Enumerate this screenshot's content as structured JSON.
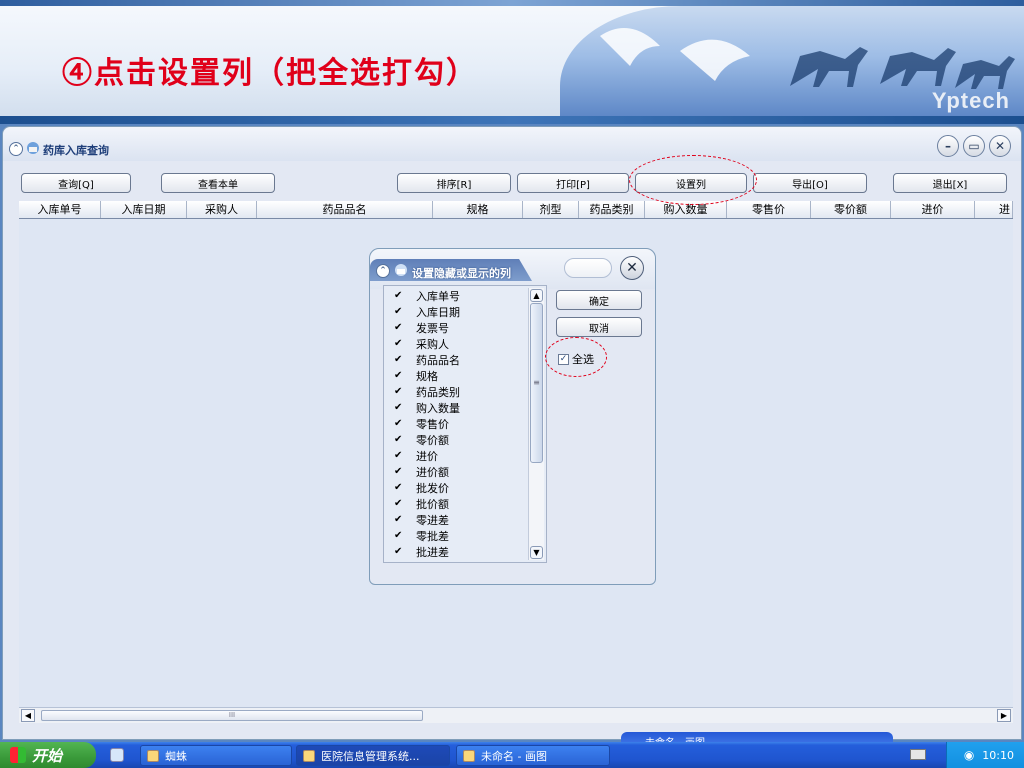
{
  "banner": {
    "title": "④点击设置列（把全选打勾）",
    "brand": "Yptech"
  },
  "main_window": {
    "title": "药库入库查询",
    "controls": {
      "minimize": "–",
      "restore": "▭",
      "close": "✕"
    },
    "toolbar": {
      "query": "查询[Q]",
      "view_order": "查看本单",
      "sort": "排序[R]",
      "print": "打印[P]",
      "set_columns": "设置列",
      "export": "导出[O]",
      "exit": "退出[X]"
    },
    "columns": [
      "入库单号",
      "入库日期",
      "采购人",
      "药品品名",
      "规格",
      "剂型",
      "药品类别",
      "购入数量",
      "零售价",
      "零价额",
      "进价",
      "进"
    ],
    "scroll": {
      "left": "◀",
      "right": "▶",
      "thumb": "III"
    }
  },
  "dialog": {
    "title": "设置隐藏或显示的列",
    "close": "✕",
    "items": [
      {
        "label": "入库单号",
        "checked": true
      },
      {
        "label": "入库日期",
        "checked": true
      },
      {
        "label": "发票号",
        "checked": true
      },
      {
        "label": "采购人",
        "checked": true
      },
      {
        "label": "药品品名",
        "checked": true
      },
      {
        "label": "规格",
        "checked": true
      },
      {
        "label": "药品类别",
        "checked": true
      },
      {
        "label": "购入数量",
        "checked": true
      },
      {
        "label": "零售价",
        "checked": true
      },
      {
        "label": "零价额",
        "checked": true
      },
      {
        "label": "进价",
        "checked": true
      },
      {
        "label": "进价额",
        "checked": true
      },
      {
        "label": "批发价",
        "checked": true
      },
      {
        "label": "批价额",
        "checked": true
      },
      {
        "label": "零进差",
        "checked": true
      },
      {
        "label": "零批差",
        "checked": true
      },
      {
        "label": "批进差",
        "checked": true
      }
    ],
    "check_glyph": "✔",
    "scroll": {
      "up": "▲",
      "down": "▼",
      "thumb": "≡"
    },
    "ok": "确定",
    "cancel": "取消",
    "select_all": {
      "label": "全选",
      "checked": true,
      "glyph": "✓"
    }
  },
  "background_window": {
    "title": "未命名 - 画图"
  },
  "taskbar": {
    "start": "开始",
    "items": [
      {
        "label": "蜘蛛",
        "active": false
      },
      {
        "label": "医院信息管理系统...",
        "active": true
      },
      {
        "label": "未命名 - 画图",
        "active": false
      }
    ],
    "clock": "10:10"
  },
  "colors": {
    "annotation": "#e0001a",
    "accent": "#245edb"
  }
}
